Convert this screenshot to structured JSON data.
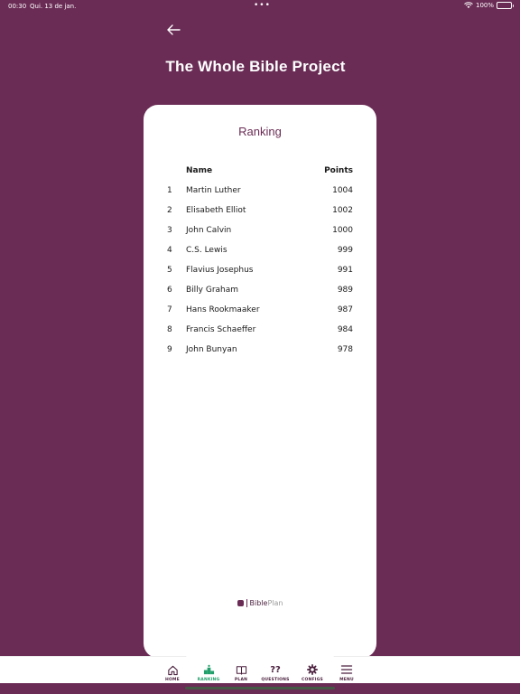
{
  "status_bar": {
    "time": "00:30",
    "date": "Qui. 13 de jan.",
    "dots": "•••",
    "battery": "100%"
  },
  "header": {
    "back_icon": "arrow-left-icon",
    "title": "The Whole Bible Project"
  },
  "card": {
    "title": "Ranking",
    "columns": {
      "name": "Name",
      "points": "Points"
    },
    "rows": [
      {
        "rank": "1",
        "name": "Martin Luther",
        "points": "1004"
      },
      {
        "rank": "2",
        "name": "Elisabeth Elliot",
        "points": "1002"
      },
      {
        "rank": "3",
        "name": "John Calvin",
        "points": "1000"
      },
      {
        "rank": "4",
        "name": "C.S. Lewis",
        "points": "999"
      },
      {
        "rank": "5",
        "name": "Flavius Josephus",
        "points": "991"
      },
      {
        "rank": "6",
        "name": "Billy Graham",
        "points": "989"
      },
      {
        "rank": "7",
        "name": "Hans Rookmaaker",
        "points": "987"
      },
      {
        "rank": "8",
        "name": "Francis Schaeffer",
        "points": "984"
      },
      {
        "rank": "9",
        "name": "John Bunyan",
        "points": "978"
      }
    ],
    "brand": {
      "part1": "Bible",
      "part2": "Plan"
    }
  },
  "tabs": [
    {
      "id": "home",
      "label": "HOME",
      "icon": "home-icon"
    },
    {
      "id": "ranking",
      "label": "RANKING",
      "icon": "podium-icon",
      "active": true
    },
    {
      "id": "plan",
      "label": "PLAN",
      "icon": "book-icon"
    },
    {
      "id": "questions",
      "label": "QUESTIONS",
      "icon": "question-icon",
      "glyph": "??"
    },
    {
      "id": "configs",
      "label": "CONFIGS",
      "icon": "gear-icon"
    },
    {
      "id": "menu",
      "label": "MENU",
      "icon": "menu-icon"
    }
  ],
  "colors": {
    "background": "#6a2c55",
    "card": "#ffffff",
    "accent_active": "#22a06b",
    "text_dark": "#4a1f3d"
  }
}
